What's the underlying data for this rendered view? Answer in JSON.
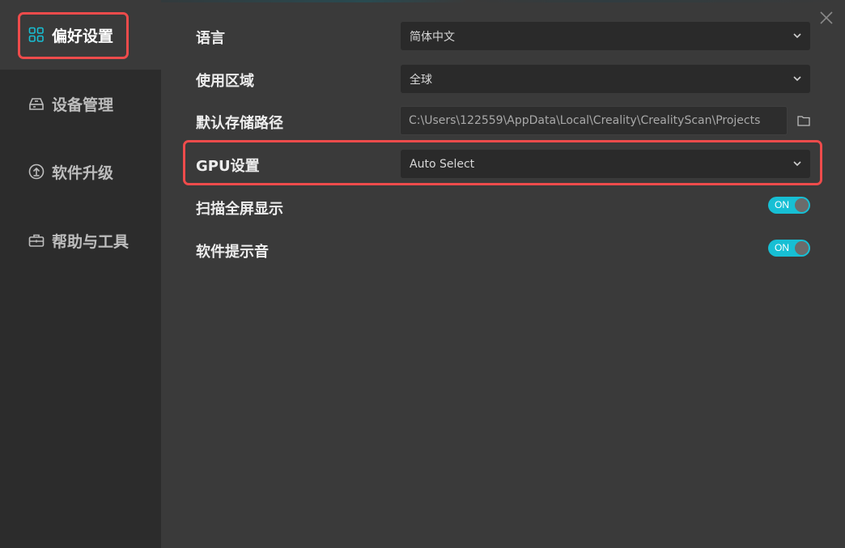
{
  "sidebar": {
    "items": [
      {
        "label": "偏好设置",
        "icon": "grid-icon",
        "active": true
      },
      {
        "label": "设备管理",
        "icon": "device-icon",
        "active": false
      },
      {
        "label": "软件升级",
        "icon": "upgrade-icon",
        "active": false
      },
      {
        "label": "帮助与工具",
        "icon": "toolbox-icon",
        "active": false
      }
    ]
  },
  "settings": {
    "language": {
      "label": "语言",
      "value": "简体中文"
    },
    "region": {
      "label": "使用区域",
      "value": "全球"
    },
    "storage_path": {
      "label": "默认存储路径",
      "value": "C:\\Users\\122559\\AppData\\Local\\Creality\\CrealityScan\\Projects"
    },
    "gpu": {
      "label": "GPU设置",
      "value": "Auto Select"
    },
    "fullscreen_scan": {
      "label": "扫描全屏显示",
      "toggle": "ON"
    },
    "sound": {
      "label": "软件提示音",
      "toggle": "ON"
    }
  },
  "colors": {
    "accent": "#17bfd4",
    "highlight": "#ee4b4b",
    "sidebar_bg": "#2c2c2c",
    "content_bg": "#3a3a3a"
  }
}
